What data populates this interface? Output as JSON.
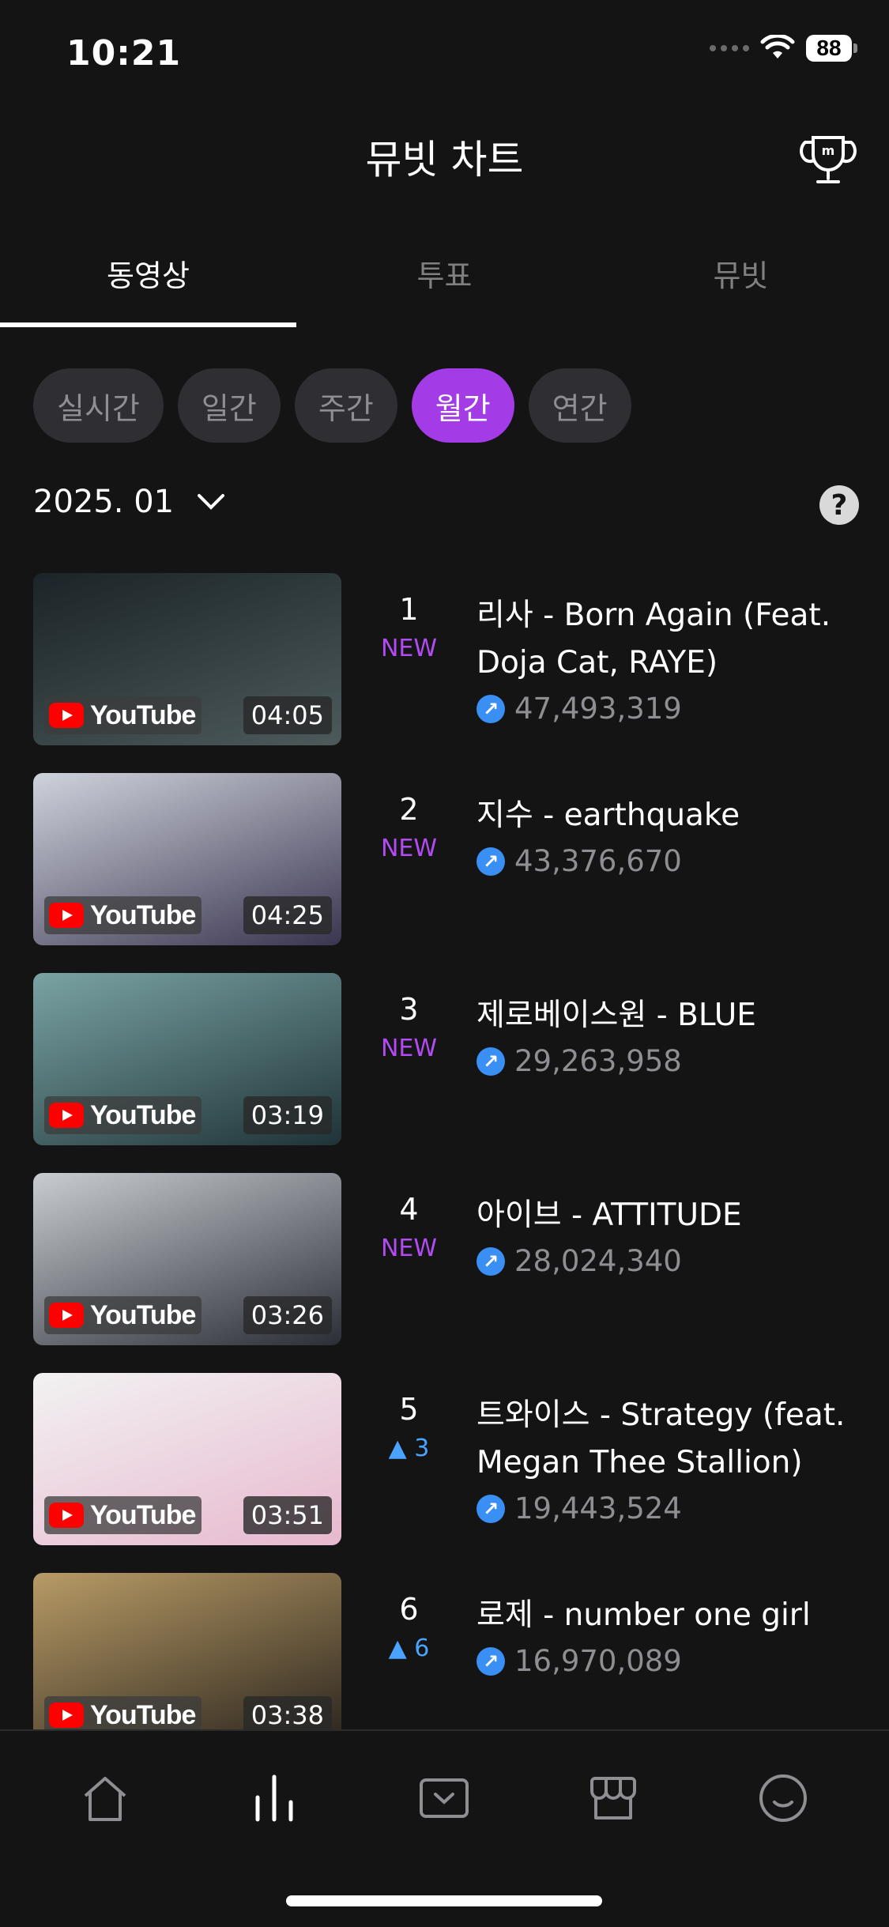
{
  "status_bar": {
    "time": "10:21",
    "battery": "88"
  },
  "header": {
    "title": "뮤빗 차트"
  },
  "tabs": [
    {
      "label": "동영상",
      "active": true
    },
    {
      "label": "투표",
      "active": false
    },
    {
      "label": "뮤빗",
      "active": false
    }
  ],
  "periods": [
    {
      "label": "실시간",
      "active": false
    },
    {
      "label": "일간",
      "active": false
    },
    {
      "label": "주간",
      "active": false
    },
    {
      "label": "월간",
      "active": true
    },
    {
      "label": "연간",
      "active": false
    }
  ],
  "date_selector": {
    "value": "2025. 01"
  },
  "help_label": "?",
  "youtube_label": "YouTube",
  "chart_items": [
    {
      "rank": "1",
      "change": "NEW",
      "change_type": "new",
      "title": "리사 - Born Again (Feat. Doja Cat, RAYE)",
      "views": "47,493,319",
      "duration": "04:05",
      "thumb_colors": [
        "#1b2428",
        "#4d5a5c"
      ]
    },
    {
      "rank": "2",
      "change": "NEW",
      "change_type": "new",
      "title": "지수 - earthquake",
      "views": "43,376,670",
      "duration": "04:25",
      "thumb_colors": [
        "#cfd3dc",
        "#3a3550"
      ]
    },
    {
      "rank": "3",
      "change": "NEW",
      "change_type": "new",
      "title": "제로베이스원 - BLUE",
      "views": "29,263,958",
      "duration": "03:19",
      "thumb_colors": [
        "#7aa3a3",
        "#1f3337"
      ]
    },
    {
      "rank": "4",
      "change": "NEW",
      "change_type": "new",
      "title": "아이브 - ATTITUDE",
      "views": "28,024,340",
      "duration": "03:26",
      "thumb_colors": [
        "#c9ccd1",
        "#2b2e36"
      ]
    },
    {
      "rank": "5",
      "change": "▲ 3",
      "change_type": "up",
      "title": "트와이스 - Strategy (feat. Megan Thee Stallion)",
      "views": "19,443,524",
      "duration": "03:51",
      "thumb_colors": [
        "#f2f2f2",
        "#e7b8cf"
      ]
    },
    {
      "rank": "6",
      "change": "▲ 6",
      "change_type": "up",
      "title": "로제 - number one girl",
      "views": "16,970,089",
      "duration": "03:38",
      "thumb_colors": [
        "#b89b66",
        "#2a241d"
      ]
    }
  ]
}
